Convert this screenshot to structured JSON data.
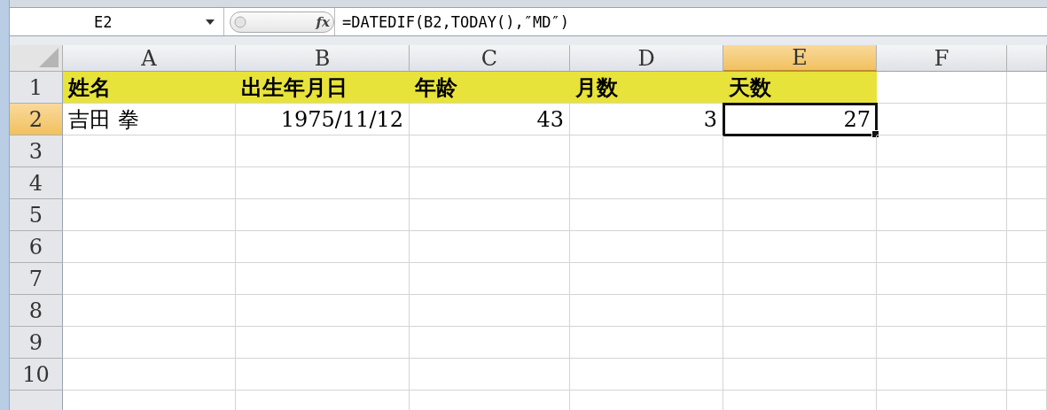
{
  "formula_bar": {
    "name_box": "E2",
    "function_label": "fx",
    "formula": "=DATEDIF(B2,TODAY(),″MD″)"
  },
  "columns": [
    {
      "label": "A",
      "selected": false
    },
    {
      "label": "B",
      "selected": false
    },
    {
      "label": "C",
      "selected": false
    },
    {
      "label": "D",
      "selected": false
    },
    {
      "label": "E",
      "selected": true
    },
    {
      "label": "F",
      "selected": false
    }
  ],
  "rows": [
    {
      "label": "1",
      "selected": false,
      "cells": [
        {
          "text": "姓名",
          "kind": "text",
          "highlight": true,
          "selected": false
        },
        {
          "text": "出生年月日",
          "kind": "text",
          "highlight": true,
          "selected": false
        },
        {
          "text": "年龄",
          "kind": "text",
          "highlight": true,
          "selected": false
        },
        {
          "text": "月数",
          "kind": "text",
          "highlight": true,
          "selected": false
        },
        {
          "text": "天数",
          "kind": "text",
          "highlight": true,
          "selected": false
        }
      ]
    },
    {
      "label": "2",
      "selected": true,
      "cells": [
        {
          "text": "吉田 拳",
          "kind": "text",
          "highlight": false,
          "selected": false
        },
        {
          "text": "1975/11/12",
          "kind": "number",
          "highlight": false,
          "selected": false
        },
        {
          "text": "43",
          "kind": "number",
          "highlight": false,
          "selected": false
        },
        {
          "text": "3",
          "kind": "number",
          "highlight": false,
          "selected": false
        },
        {
          "text": "27",
          "kind": "number",
          "highlight": false,
          "selected": true
        }
      ]
    },
    {
      "label": "3",
      "selected": false,
      "cells": []
    },
    {
      "label": "4",
      "selected": false,
      "cells": []
    },
    {
      "label": "5",
      "selected": false,
      "cells": []
    },
    {
      "label": "6",
      "selected": false,
      "cells": []
    },
    {
      "label": "7",
      "selected": false,
      "cells": []
    },
    {
      "label": "8",
      "selected": false,
      "cells": []
    },
    {
      "label": "9",
      "selected": false,
      "cells": []
    },
    {
      "label": "10",
      "selected": false,
      "cells": []
    }
  ]
}
